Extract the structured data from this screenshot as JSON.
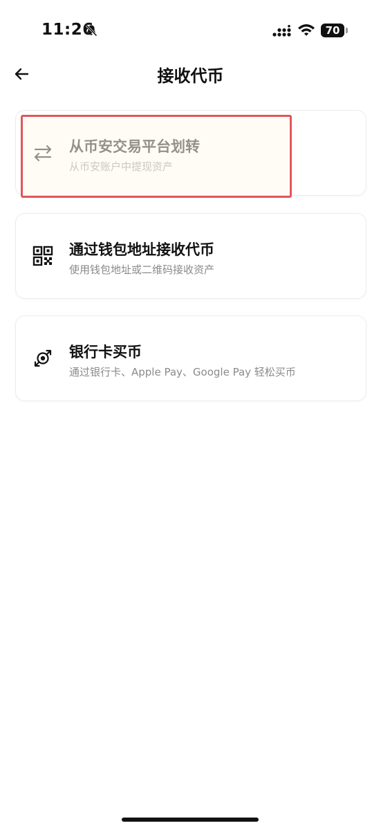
{
  "status_bar": {
    "time": "11:26",
    "battery": "70"
  },
  "header": {
    "title": "接收代币"
  },
  "options": [
    {
      "label": "从币安交易平台划转",
      "description": "从币安账户中提现资产",
      "icon": "transfer-arrows-icon"
    },
    {
      "label": "通过钱包地址接收代币",
      "description": "使用钱包地址或二维码接收资产",
      "icon": "qr-code-icon"
    },
    {
      "label": "银行卡买币",
      "description": "通过银行卡、Apple Pay、Google Pay 轻松买币",
      "icon": "buy-crypto-icon"
    }
  ],
  "colors": {
    "highlight": "#e0565b",
    "muted_text": "#8a8a8a",
    "text": "#111111"
  }
}
